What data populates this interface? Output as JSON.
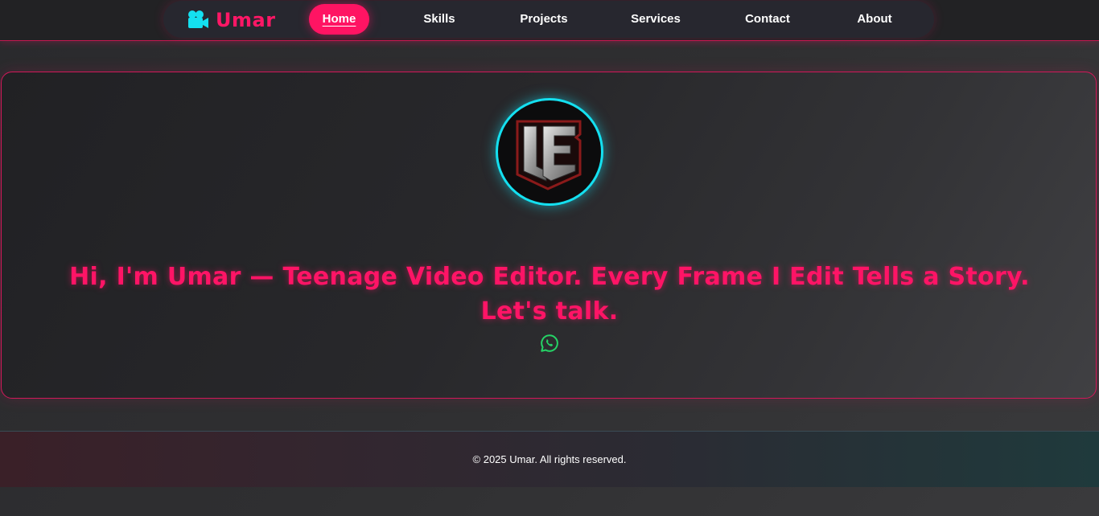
{
  "brand": {
    "name": "Umar",
    "icon": "video-camera-icon",
    "color": "#ff1766"
  },
  "nav": {
    "items": [
      {
        "label": "Home",
        "active": true
      },
      {
        "label": "Skills",
        "active": false
      },
      {
        "label": "Projects",
        "active": false
      },
      {
        "label": "Services",
        "active": false
      },
      {
        "label": "Contact",
        "active": false
      },
      {
        "label": "About",
        "active": false
      }
    ]
  },
  "hero": {
    "avatar_logo": "UE",
    "headline_line1": "Hi, I'm Umar — Teenage Video Editor. Every Frame I Edit Tells a Story.",
    "headline_line2": "Let's talk.",
    "contact_icon": "whatsapp-icon"
  },
  "footer": {
    "text": "© 2025 Umar. All rights reserved."
  },
  "colors": {
    "accent": "#ff1466",
    "cyan": "#14e0f0",
    "whatsapp": "#25d366"
  }
}
